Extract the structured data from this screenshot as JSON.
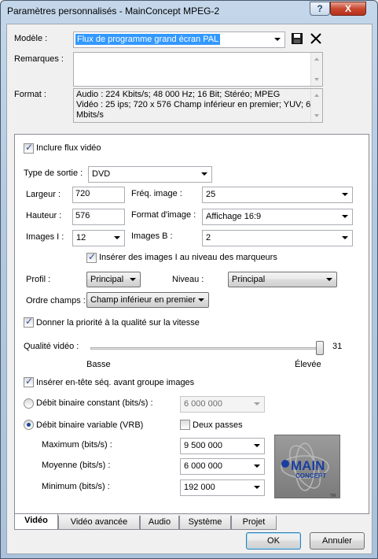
{
  "window": {
    "title": "Paramètres personnalisés - MainConcept MPEG-2",
    "help_label": "?",
    "close_label": "X"
  },
  "header": {
    "model_label": "Modèle :",
    "model_value": "Flux de programme grand écran PAL",
    "remarks_label": "Remarques :",
    "remarks_value": "",
    "format_label": "Format :",
    "format_line1": "Audio : 224 Kbits/s; 48 000 Hz; 16 Bit; Stéréo; MPEG",
    "format_line2": "Vidéo : 25 ips; 720 x 576 Champ inférieur en premier; YUV; 6",
    "format_line3": "Mbits/s"
  },
  "video": {
    "include_label": "Inclure flux vidéo",
    "include_checked": true,
    "output_type_label": "Type de sortie :",
    "output_type_value": "DVD",
    "width_label": "Largeur :",
    "width_value": "720",
    "height_label": "Hauteur :",
    "height_value": "576",
    "framerate_label": "Fréq. image :",
    "framerate_value": "25",
    "aspect_label": "Format d'image :",
    "aspect_value": "Affichage 16:9",
    "i_frames_label": "Images I :",
    "i_frames_value": "12",
    "b_frames_label": "Images B :",
    "b_frames_value": "2",
    "insert_i_label": "Insérer des images I au niveau des marqueurs",
    "insert_i_checked": true,
    "profile_label": "Profil :",
    "profile_value": "Principal",
    "level_label": "Niveau :",
    "level_value": "Principal",
    "field_order_label": "Ordre champs :",
    "field_order_value": "Champ inférieur en premier",
    "quality_priority_label": "Donner la priorité à la qualité sur la vitesse",
    "quality_priority_checked": true,
    "quality_label": "Qualité vidéo :",
    "quality_value": "31",
    "quality_max": 31,
    "quality_min_label": "Basse",
    "quality_max_label": "Élevée",
    "seq_header_label": "Insérer en-tête séq. avant groupe images",
    "seq_header_checked": true,
    "cbr_label": "Débit binaire constant (bits/s) :",
    "cbr_value": "6 000 000",
    "cbr_selected": false,
    "vbr_label": "Débit binaire variable (VRB)",
    "vbr_selected": true,
    "two_pass_label": "Deux passes",
    "two_pass_checked": false,
    "max_label": "Maximum (bits/s) :",
    "max_value": "9 500 000",
    "avg_label": "Moyenne (bits/s) :",
    "avg_value": "6 000 000",
    "min_label": "Minimum (bits/s) :",
    "min_value": "192 000",
    "logo_text_1": "MAIN",
    "logo_text_2": "CONCEPT",
    "logo_tm": "TM"
  },
  "tabs": [
    {
      "label": "Vidéo",
      "active": true
    },
    {
      "label": "Vidéo avancée",
      "active": false
    },
    {
      "label": "Audio",
      "active": false
    },
    {
      "label": "Système",
      "active": false
    },
    {
      "label": "Projet",
      "active": false
    }
  ],
  "buttons": {
    "ok": "OK",
    "cancel": "Annuler"
  },
  "colors": {
    "selection": "#3399ff",
    "logo_blue": "#1b3f9e"
  }
}
